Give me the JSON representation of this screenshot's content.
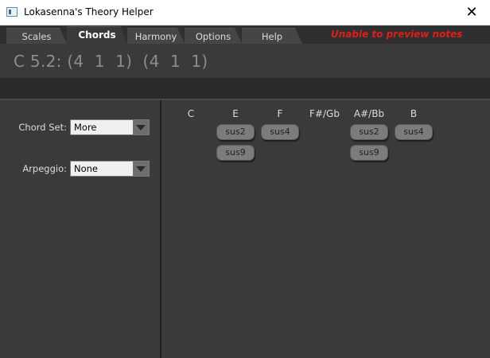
{
  "window": {
    "title": "Lokasenna's Theory Helper",
    "close_glyph": "✕"
  },
  "tabs": [
    {
      "label": "Scales"
    },
    {
      "label": "Chords"
    },
    {
      "label": "Harmony"
    },
    {
      "label": "Options"
    },
    {
      "label": "Help"
    }
  ],
  "active_tab": "Chords",
  "warning": "Unable to preview notes",
  "chord_display": "C 5.2: (4  1  1)  (4  1  1)",
  "left": {
    "chord_set": {
      "label": "Chord Set:",
      "value": "More"
    },
    "arpeggio": {
      "label": "Arpeggio:",
      "value": "None"
    }
  },
  "columns": [
    "C",
    "E",
    "F",
    "F#/Gb",
    "A#/Bb",
    "B"
  ],
  "buttons": {
    "e": [
      "sus2",
      "sus9"
    ],
    "f": [
      "sus4"
    ],
    "asbb": [
      "sus2",
      "sus9"
    ],
    "b": [
      "sus4"
    ]
  },
  "colors": {
    "warning": "#dd1e1e",
    "background": "#3a3a3a",
    "button": "#7c7c7c"
  }
}
